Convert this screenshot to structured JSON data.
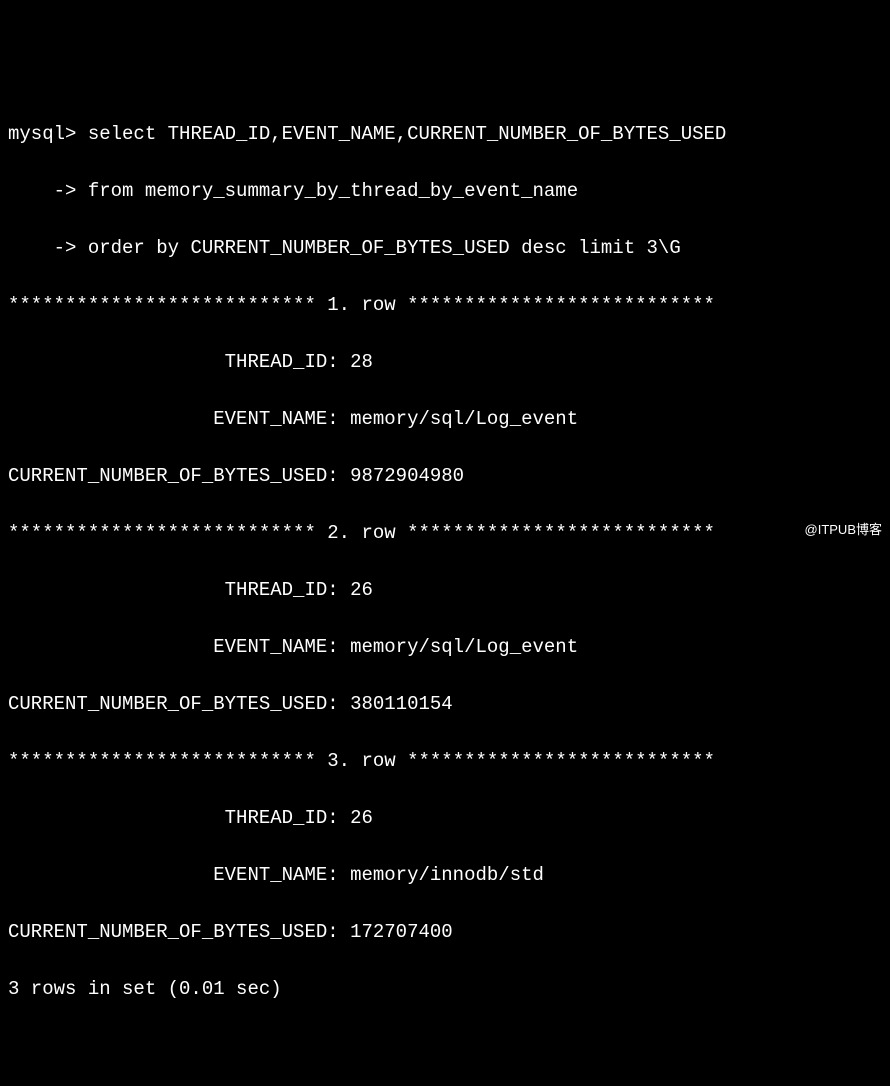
{
  "prompt": "mysql>",
  "continuation": "    ->",
  "query": {
    "line1": " select THREAD_ID,EVENT_NAME,CURRENT_NUMBER_OF_BYTES_USED",
    "line2": " from memory_summary_by_thread_by_event_name",
    "line3": " order by CURRENT_NUMBER_OF_BYTES_USED desc limit 3\\G"
  },
  "separator_left": "*************************** ",
  "separator_right": " ***************************",
  "row_label_1": "1. row",
  "row_label_2": "2. row",
  "row_label_3": "3. row",
  "field_labels": {
    "thread_id": "                   THREAD_ID: ",
    "event_name": "                  EVENT_NAME: ",
    "bytes_used": "CURRENT_NUMBER_OF_BYTES_USED: "
  },
  "rows": [
    {
      "THREAD_ID": "28",
      "EVENT_NAME": "memory/sql/Log_event",
      "CURRENT_NUMBER_OF_BYTES_USED": "9872904980"
    },
    {
      "THREAD_ID": "26",
      "EVENT_NAME": "memory/sql/Log_event",
      "CURRENT_NUMBER_OF_BYTES_USED": "380110154"
    },
    {
      "THREAD_ID": "26",
      "EVENT_NAME": "memory/innodb/std",
      "CURRENT_NUMBER_OF_BYTES_USED": "172707400"
    }
  ],
  "footer": "3 rows in set (0.01 sec)",
  "watermark": "@ITPUB博客"
}
